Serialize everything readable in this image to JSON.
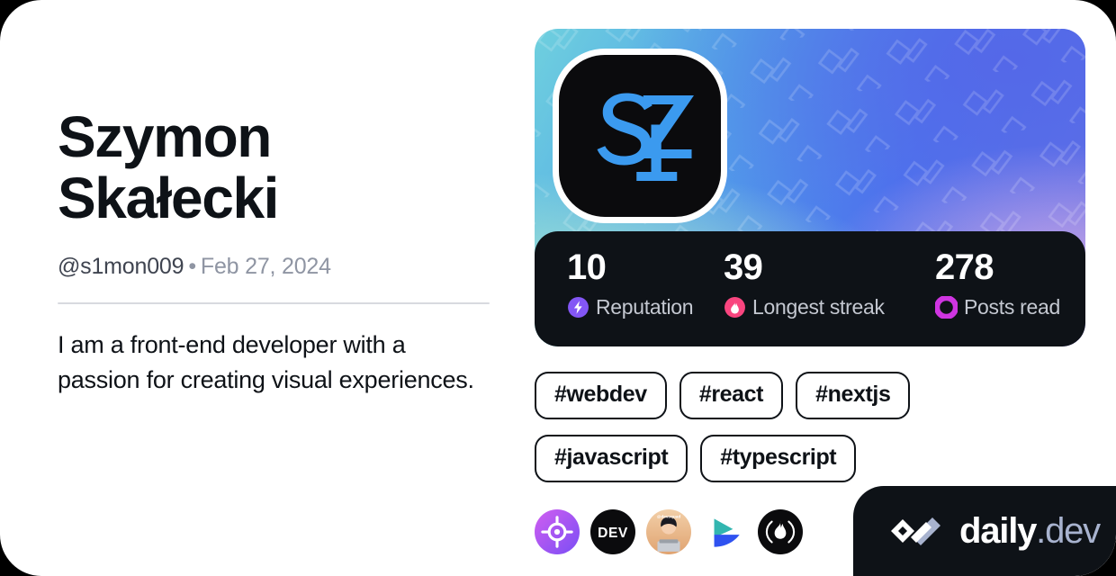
{
  "background_color": "#000000",
  "card": {
    "background_color": "#ffffff"
  },
  "profile": {
    "display_name": "Szymon\nSkałecki",
    "handle": "@s1mon009",
    "separator": "•",
    "date": "Feb 27, 2024",
    "bio": "I am a front-end developer with a passion for creating visual experiences.",
    "avatar_monogram": "SZ",
    "avatar_monogram_color": "#3b9aef",
    "avatar_background": "#0b0b0d"
  },
  "stats": {
    "background_color": "#0e1217",
    "items": [
      {
        "value": "10",
        "label": "Reputation",
        "icon": "bolt-icon",
        "icon_color": "#8356f5"
      },
      {
        "value": "39",
        "label": "Longest streak",
        "icon": "flame-icon",
        "icon_color": "#f9457f"
      },
      {
        "value": "278",
        "label": "Posts read",
        "icon": "ring-icon",
        "icon_color": "#cf35e1"
      }
    ]
  },
  "tags": [
    {
      "label": "#webdev"
    },
    {
      "label": "#react"
    },
    {
      "label": "#nextjs"
    },
    {
      "label": "#javascript"
    },
    {
      "label": "#typescript"
    }
  ],
  "sources": [
    {
      "name": "crosshair-source-icon",
      "color": "#a855f7"
    },
    {
      "name": "dev-to-source-icon",
      "color": "#0e1217"
    },
    {
      "name": "avatar-source-icon",
      "color": "#e8b98c"
    },
    {
      "name": "play-triangle-source-icon",
      "color": "#2f52f0"
    },
    {
      "name": "flame-circle-source-icon",
      "color": "#0e1217"
    }
  ],
  "badge": {
    "name_primary": "daily",
    "name_secondary": ".dev",
    "background_color": "#0e1217"
  }
}
